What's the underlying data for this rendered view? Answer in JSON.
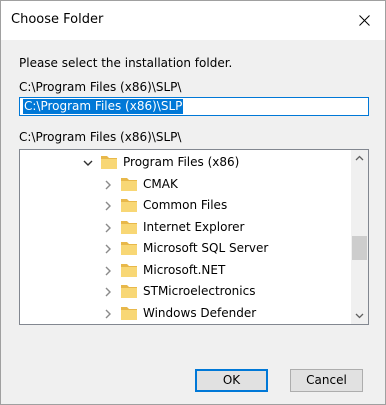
{
  "window": {
    "title": "Choose Folder",
    "close_glyph": "close-icon"
  },
  "instruction": "Please select the installation folder.",
  "current_path_label": "C:\\Program Files (x86)\\SLP\\",
  "path_input": {
    "value": "C:\\Program Files (x86)\\SLP"
  },
  "tree_path_label": "C:\\Program Files (x86)\\SLP\\",
  "tree": {
    "items": [
      {
        "label": "Program Files (x86)",
        "level": 0,
        "expanded": true
      },
      {
        "label": "CMAK",
        "level": 1,
        "expanded": false
      },
      {
        "label": "Common Files",
        "level": 1,
        "expanded": false
      },
      {
        "label": "Internet Explorer",
        "level": 1,
        "expanded": false
      },
      {
        "label": "Microsoft SQL Server",
        "level": 1,
        "expanded": false
      },
      {
        "label": "Microsoft.NET",
        "level": 1,
        "expanded": false
      },
      {
        "label": "STMicroelectronics",
        "level": 1,
        "expanded": false
      },
      {
        "label": "Windows Defender",
        "level": 1,
        "expanded": false
      }
    ]
  },
  "buttons": {
    "ok": "OK",
    "cancel": "Cancel"
  },
  "colors": {
    "accent": "#0078d7",
    "folder": "#f8d775",
    "folder_dark": "#e8b84a",
    "dialog_bg": "#f0f0f0"
  }
}
